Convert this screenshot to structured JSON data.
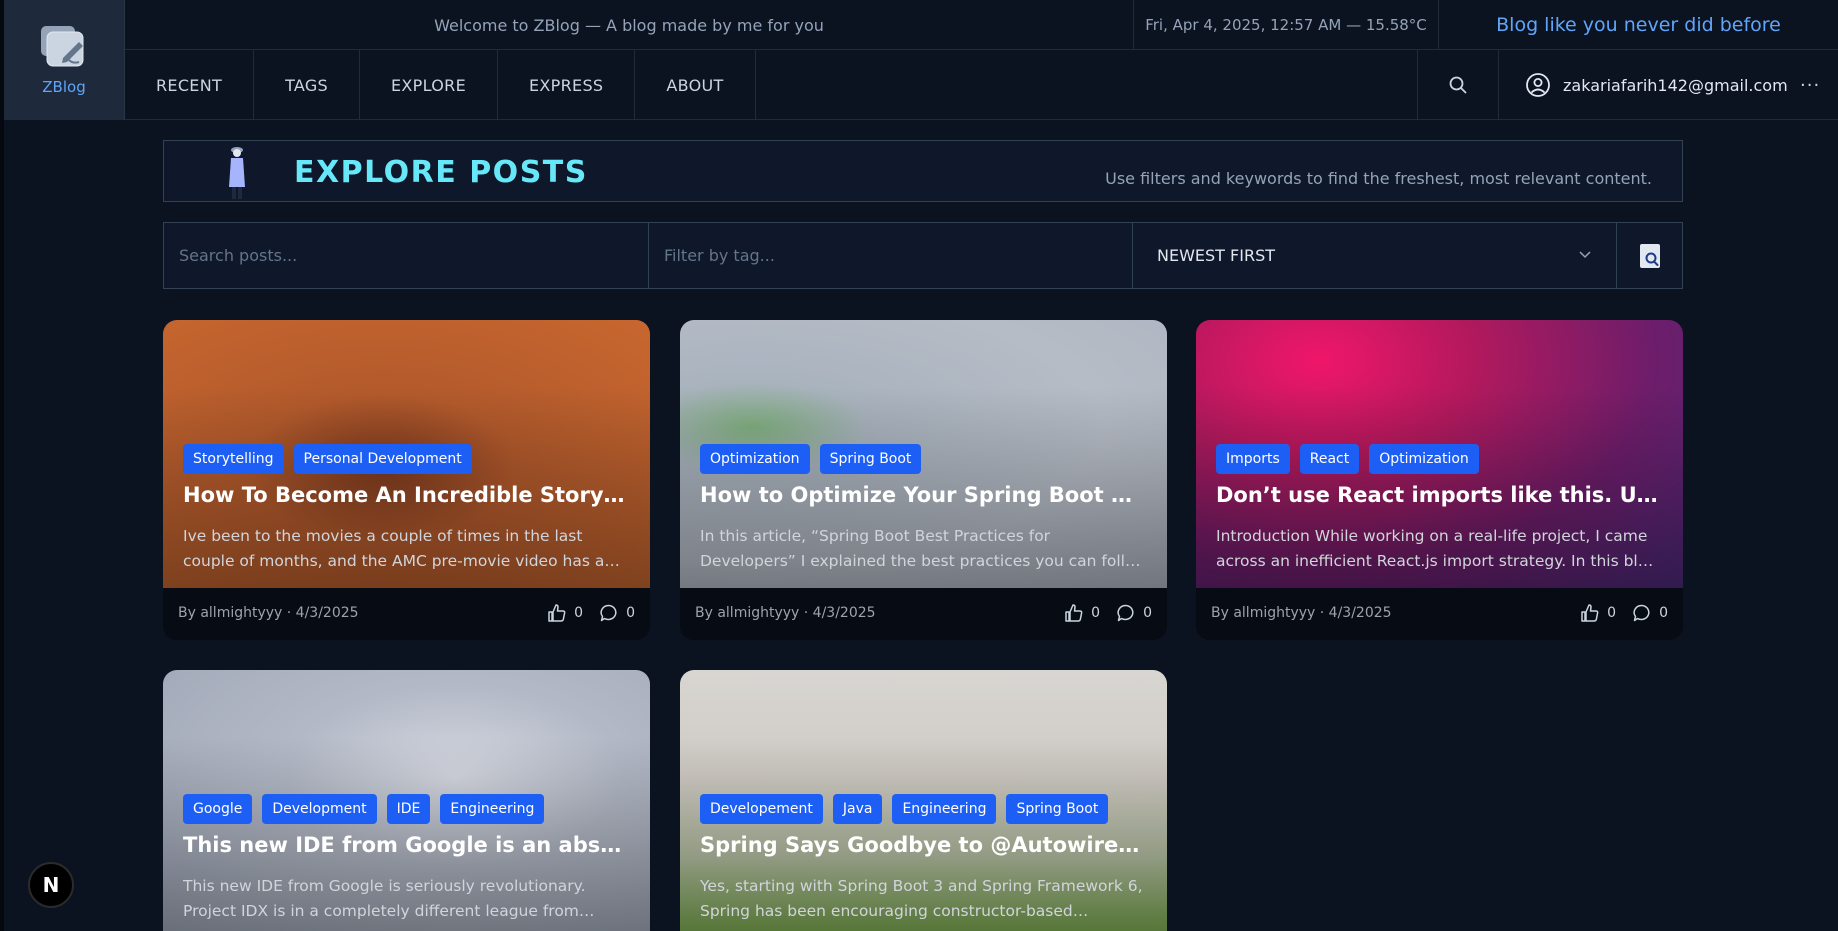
{
  "brand": {
    "name": "ZBlog",
    "icon": "notebook-pencil-icon"
  },
  "header": {
    "welcome": "Welcome to ZBlog — A blog made by me for you",
    "datetime": "Fri, Apr 4, 2025, 12:57 AM — 15.58°C",
    "tagline": "Blog like you never did before",
    "nav": [
      "RECENT",
      "TAGS",
      "EXPLORE",
      "EXPRESS",
      "ABOUT"
    ],
    "user_email": "zakariafarih142@gmail.com",
    "more": "···"
  },
  "explore": {
    "title": "EXPLORE POSTS",
    "subtitle": "Use filters and keywords to find the freshest, most relevant content."
  },
  "filters": {
    "search_placeholder": "Search posts...",
    "tag_placeholder": "Filter by tag...",
    "sort_value": "NEWEST FIRST"
  },
  "posts": [
    {
      "tags": [
        "Storytelling",
        "Personal Development"
      ],
      "title": "How To Become An Incredible Storyteller",
      "excerpt": "Ive been to the movies a couple of times in the last couple of months, and the AMC pre-movie video has a…",
      "byline": "By allmightyyy · 4/3/2025",
      "likes": "0",
      "comments": "0"
    },
    {
      "tags": [
        "Optimization",
        "Spring Boot"
      ],
      "title": "How to Optimize Your Spring Boot App…",
      "excerpt": "In this article, “Spring Boot Best Practices for Developers” I explained the best practices you can foll…",
      "byline": "By allmightyyy · 4/3/2025",
      "likes": "0",
      "comments": "0"
    },
    {
      "tags": [
        "Imports",
        "React",
        "Optimization"
      ],
      "title": "Don’t use React imports like this. Use…",
      "excerpt": "Introduction While working on a real-life project, I came across an inefficient React.js import strategy. In this bl…",
      "byline": "By allmightyyy · 4/3/2025",
      "likes": "0",
      "comments": "0"
    },
    {
      "tags": [
        "Google",
        "Development",
        "IDE",
        "Engineering"
      ],
      "title": "This new IDE from Google is an absolute…",
      "excerpt": "This new IDE from Google is seriously revolutionary. Project IDX is in a completely different league from…"
    },
    {
      "tags": [
        "Developement",
        "Java",
        "Engineering",
        "Spring Boot"
      ],
      "title": "Spring Says Goodbye to @Autowired:…",
      "excerpt": "Yes, starting with Spring Boot 3 and Spring Framework 6, Spring has been encouraging constructor-based…"
    }
  ],
  "badge": {
    "letter": "N"
  }
}
